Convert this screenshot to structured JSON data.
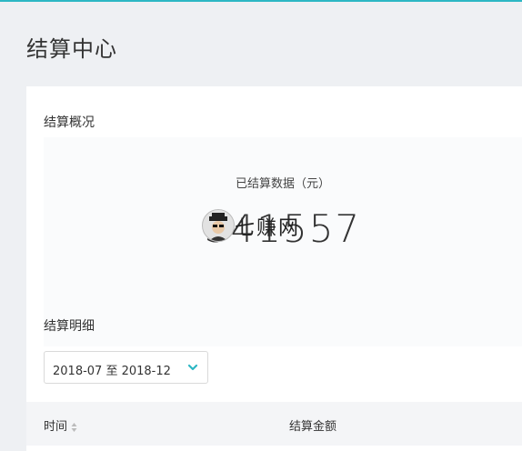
{
  "page": {
    "title": "结算中心"
  },
  "overview": {
    "title": "结算概况",
    "settled_label": "已结算数据（元）",
    "settled_value": "341557"
  },
  "watermark": {
    "text": "七赚网"
  },
  "detail": {
    "title": "结算明细",
    "date_range": "2018-07 至 2018-12"
  },
  "table": {
    "columns": [
      "时间",
      "结算金额"
    ]
  },
  "colors": {
    "accent": "#2db7c4",
    "background": "#eef0f3",
    "card": "#ffffff",
    "table_header": "#f4f5f7"
  }
}
